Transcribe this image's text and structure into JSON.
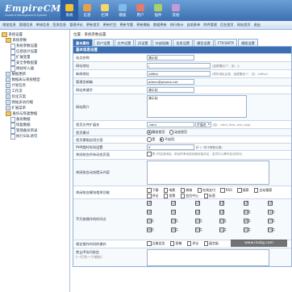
{
  "header": {
    "logo": "EmpireCMS",
    "logo_sub": "Content Management System",
    "tabs": [
      {
        "label": "系统",
        "icon": "system-icon",
        "color": "#f2c230",
        "active": true
      },
      {
        "label": "信息",
        "icon": "info-icon",
        "color": "#e8a04a"
      },
      {
        "label": "栏目",
        "icon": "column-icon",
        "color": "#f5d76b"
      },
      {
        "label": "模板",
        "icon": "template-icon",
        "color": "#7fbbe6"
      },
      {
        "label": "用户",
        "icon": "user-icon",
        "color": "#e27b6a"
      },
      {
        "label": "插件",
        "icon": "plugin-icon",
        "color": "#a6d26b"
      },
      {
        "label": "其他",
        "icon": "other-icon",
        "color": "#c59ad8"
      }
    ]
  },
  "subnav": [
    "增加信息",
    "管理信息",
    "审核信息",
    "签发信息",
    "管理评论",
    "更新首页",
    "更新栏目",
    "更新专题",
    "更新模板",
    "数据更新",
    "排行统计",
    "自助表单",
    "附件管理",
    "后台首页",
    "网站首页",
    "退出"
  ],
  "sidebar": {
    "items": [
      {
        "label": "系统设置",
        "level": 0,
        "type": "folder"
      },
      {
        "label": "系统参数",
        "level": 1,
        "type": "folder"
      },
      {
        "label": "系统参数设置",
        "level": 2,
        "type": "page"
      },
      {
        "label": "信息统计设置",
        "level": 2,
        "type": "page"
      },
      {
        "label": "扩展变量",
        "level": 2,
        "type": "page"
      },
      {
        "label": "安全参数配置",
        "level": 2,
        "type": "page"
      },
      {
        "label": "网站导入器",
        "level": 2,
        "type": "page"
      },
      {
        "label": "数据更新",
        "level": 1,
        "type": "box"
      },
      {
        "label": "数据表与系统模型",
        "level": 1,
        "type": "box"
      },
      {
        "label": "计划任务",
        "level": 1,
        "type": "box"
      },
      {
        "label": "工作流",
        "level": 1,
        "type": "box"
      },
      {
        "label": "优化方案",
        "level": 1,
        "type": "box"
      },
      {
        "label": "网站多访问端",
        "level": 1,
        "type": "box"
      },
      {
        "label": "扩展菜单",
        "level": 1,
        "type": "box"
      },
      {
        "label": "备份与恢复数据",
        "level": 1,
        "type": "folder"
      },
      {
        "label": "备份数据",
        "level": 2,
        "type": "page"
      },
      {
        "label": "恢复数据",
        "level": 2,
        "type": "page"
      },
      {
        "label": "管理备份目录",
        "level": 2,
        "type": "page"
      },
      {
        "label": "执行SQL语句",
        "level": 2,
        "type": "page"
      }
    ]
  },
  "breadcrumb": "位置：系统参数设置",
  "tabs": [
    "基本属性",
    "用户设置",
    "文件设置",
    "JS设置",
    "外部投稿",
    "信息设置",
    "模型设置",
    "FTP/SMTP",
    "模版设置"
  ],
  "section_title": "基本信息设置",
  "fields": {
    "site_name": {
      "label": "站点名称",
      "value": "演示站"
    },
    "site_url": {
      "label": "网站地址",
      "value": "/",
      "hint": "(结尾需加\"/\"，如：/)"
    },
    "news_url": {
      "label": "新闻地址",
      "value": "/d/file/",
      "hint": "(附件地址目录，结尾需加\"/\"，如：/d/file/)"
    },
    "admin_email": {
      "label": "管理员邮箱",
      "value": "admin@phome.net"
    },
    "keywords": {
      "label": "网站关键字",
      "value": "演示站"
    },
    "description": {
      "label": "网站简介",
      "value": "演示站"
    },
    "index_ext": {
      "label": "首页文件扩展名",
      "value": ".html",
      "select": "扩展名",
      "hint": "(如：.html,.htm,.xml,.php)"
    },
    "index_mode": {
      "label": "首页模式",
      "options": [
        "静态首页",
        "动态首页"
      ],
      "selected": 0
    },
    "index_template_list": {
      "label": "首页模版启用方案",
      "options": [
        "是",
        "不启用"
      ],
      "selected": 1
    },
    "php_timeout": {
      "label": "PHP超时时间设置",
      "value": "0",
      "hint": "秒 (一般不需要设置)"
    },
    "close_site": {
      "label": "关闭前台所有动态页面",
      "text": "是 (开启关闭后，前台所有动态页面包括评论、会员中心等均无法访问)"
    },
    "close_msg": {
      "label": "关闭前台动态提示内容"
    },
    "close_modules": {
      "label": "关闭前台模块相关功能",
      "options": [
        "下载",
        "电影",
        "商城",
        "在线支付",
        "RSS",
        "搜索",
        "全站搜索",
        "评论",
        "投票",
        "会员中心",
        "标签"
      ]
    },
    "open_hours": {
      "label": "不开放操作的时间点",
      "hours": [
        "0点",
        "1点",
        "2点",
        "3点",
        "4点",
        "5点",
        "6点",
        "7点",
        "8点",
        "9点",
        "10点",
        "11点",
        "12点",
        "13点",
        "14点",
        "15点",
        "16点",
        "17点",
        "18点",
        "19点",
        "20点",
        "21点",
        "22点",
        "23点"
      ]
    },
    "limit_ops": {
      "label": "限定操作时间的操作",
      "options": [
        "注册会员",
        "投稿",
        "评论",
        "留言板"
      ]
    },
    "deny_ip": {
      "label": "禁止IP访问前台",
      "hint": "(一行为一个地址)"
    }
  },
  "watermark": "www.niubg.com"
}
